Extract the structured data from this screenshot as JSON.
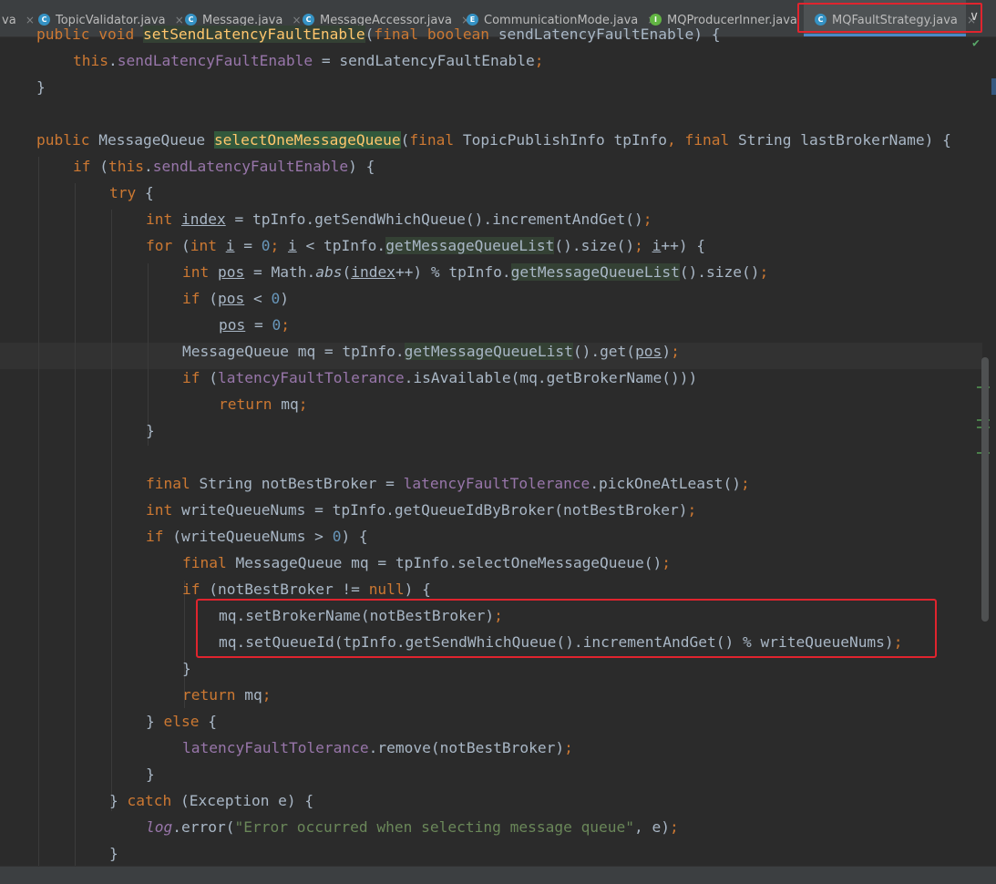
{
  "tabs": [
    {
      "label": "va",
      "icon": "",
      "icon_color": ""
    },
    {
      "label": "TopicValidator.java",
      "icon": "C",
      "icon_color": "#3592c4"
    },
    {
      "label": "Message.java",
      "icon": "C",
      "icon_color": "#3592c4"
    },
    {
      "label": "MessageAccessor.java",
      "icon": "C",
      "icon_color": "#3592c4"
    },
    {
      "label": "CommunicationMode.java",
      "icon": "E",
      "icon_color": "#3592c4"
    },
    {
      "label": "MQProducerInner.java",
      "icon": "I",
      "icon_color": "#62b543"
    },
    {
      "label": "MQFaultStrategy.java",
      "icon": "C",
      "icon_color": "#3592c4"
    }
  ],
  "tab_close_glyph": "×",
  "more_glyph": "∨",
  "check_glyph": "✔",
  "code": {
    "l01": {
      "a": "public void ",
      "b": "setSendLatencyFaultEnable",
      "c": "(",
      "d": "final boolean ",
      "e": "sendLatencyFaultEnable) {"
    },
    "l02": {
      "a": "this",
      "b": ".",
      "c": "sendLatencyFaultEnable",
      "d": " = sendLatencyFaultEnable",
      "e": ";"
    },
    "l03": {
      "a": "}"
    },
    "l04": {
      "a": "public ",
      "b": "MessageQueue ",
      "c": "selectOneMessageQueue",
      "d": "(",
      "e": "final ",
      "f": "TopicPublishInfo tpInfo",
      "g": ", ",
      "h": "final ",
      "i": "String lastBrokerName) {"
    },
    "l05": {
      "a": "if ",
      "b": "(",
      "c": "this",
      "d": ".",
      "e": "sendLatencyFaultEnable",
      "f": ") {"
    },
    "l06": {
      "a": "try ",
      "b": "{"
    },
    "l07": {
      "a": "int ",
      "b": "index",
      "c": " = tpInfo.getSendWhichQueue().incrementAndGet()",
      "d": ";"
    },
    "l08": {
      "a": "for ",
      "b": "(",
      "c": "int ",
      "d": "i",
      "e": " = ",
      "f": "0",
      "g": "; ",
      "h": "i",
      "i": " < tpInfo.",
      "j": "getMessageQueueList",
      "k": "().size()",
      "l": "; ",
      "m": "i",
      "n": "++) {"
    },
    "l09": {
      "a": "int ",
      "b": "pos",
      "c": " = Math.",
      "d": "abs",
      "e": "(",
      "f": "index",
      "g": "++) % tpInfo.",
      "h": "getMessageQueueList",
      "i": "().size()",
      "j": ";"
    },
    "l10": {
      "a": "if ",
      "b": "(",
      "c": "pos",
      "d": " < ",
      "e": "0",
      "f": ")"
    },
    "l11": {
      "a": "pos",
      "b": " = ",
      "c": "0",
      "d": ";"
    },
    "l12": {
      "a": "MessageQueue mq = tpInfo.",
      "b": "getMessageQueueList",
      "c": "().get(",
      "d": "pos",
      "e": ")",
      "f": ";"
    },
    "l13": {
      "a": "if ",
      "b": "(",
      "c": "latencyFaultTolerance",
      "d": ".isAvailable(mq.getBrokerName()))"
    },
    "l14": {
      "a": "return ",
      "b": "mq",
      "c": ";"
    },
    "l15": {
      "a": "}"
    },
    "l16": {
      "a": "final ",
      "b": "String notBestBroker = ",
      "c": "latencyFaultTolerance",
      "d": ".pickOneAtLeast()",
      "e": ";"
    },
    "l17": {
      "a": "int ",
      "b": "writeQueueNums = tpInfo.getQueueIdByBroker(notBestBroker)",
      "c": ";"
    },
    "l18": {
      "a": "if ",
      "b": "(writeQueueNums > ",
      "c": "0",
      "d": ") {"
    },
    "l19": {
      "a": "final ",
      "b": "MessageQueue mq = tpInfo.selectOneMessageQueue()",
      "c": ";"
    },
    "l20": {
      "a": "if ",
      "b": "(notBestBroker != ",
      "c": "null",
      "d": ") {"
    },
    "l21": {
      "a": "mq.setBrokerName(notBestBroker)",
      "b": ";"
    },
    "l22": {
      "a": "mq.setQueueId(tpInfo.getSendWhichQueue().incrementAndGet() % writeQueueNums)",
      "b": ";"
    },
    "l23": {
      "a": "}"
    },
    "l24": {
      "a": "return ",
      "b": "mq",
      "c": ";"
    },
    "l25": {
      "a": "} ",
      "b": "else ",
      "c": "{"
    },
    "l26": {
      "a": "latencyFaultTolerance",
      "b": ".remove(notBestBroker)",
      "c": ";"
    },
    "l27": {
      "a": "}"
    },
    "l28": {
      "a": "} ",
      "b": "catch ",
      "c": "(Exception e) {"
    },
    "l29": {
      "a": "log",
      "b": ".error(",
      "c": "\"Error occurred when selecting message queue\"",
      "d": ", e)",
      "e": ";"
    },
    "l30": {
      "a": "}"
    }
  }
}
